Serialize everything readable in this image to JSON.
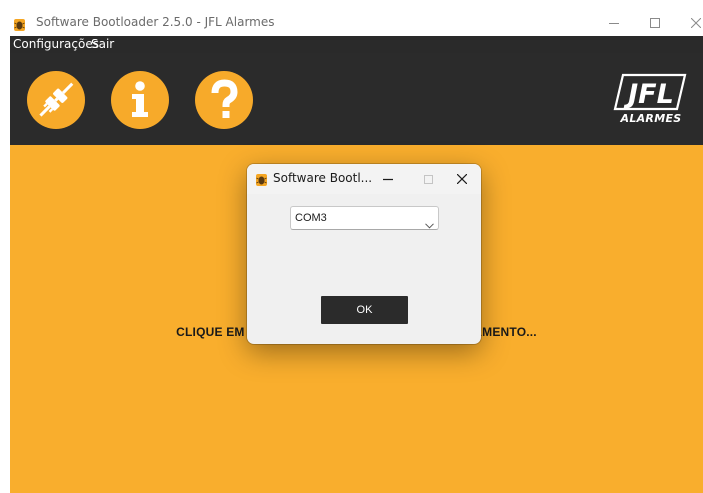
{
  "window": {
    "title": "Software Bootloader 2.5.0 - JFL Alarmes",
    "controls": [
      "minimize-icon",
      "maximize-icon",
      "close-icon"
    ]
  },
  "menubar": {
    "items": [
      {
        "label": "Configurações"
      },
      {
        "label": "Sair"
      }
    ]
  },
  "toolbar": {
    "buttons": [
      {
        "icon": "plug-connect-icon"
      },
      {
        "icon": "info-icon"
      },
      {
        "icon": "help-icon"
      }
    ],
    "logo": {
      "icon": "jfl-logo",
      "mark": "JFL",
      "subtitle": "ALARMES"
    }
  },
  "main": {
    "status_text": "CLIQUE EM CONECTAR PARA INICIAR O CARREGAMENTO..."
  },
  "dialog": {
    "title": "Software Bootl...",
    "port_select": {
      "value": "COM3"
    },
    "ok_label": "OK"
  },
  "colors": {
    "accent": "#f9ae2d",
    "dark": "#2b2b2b",
    "menubar": "#2a2a2a"
  }
}
